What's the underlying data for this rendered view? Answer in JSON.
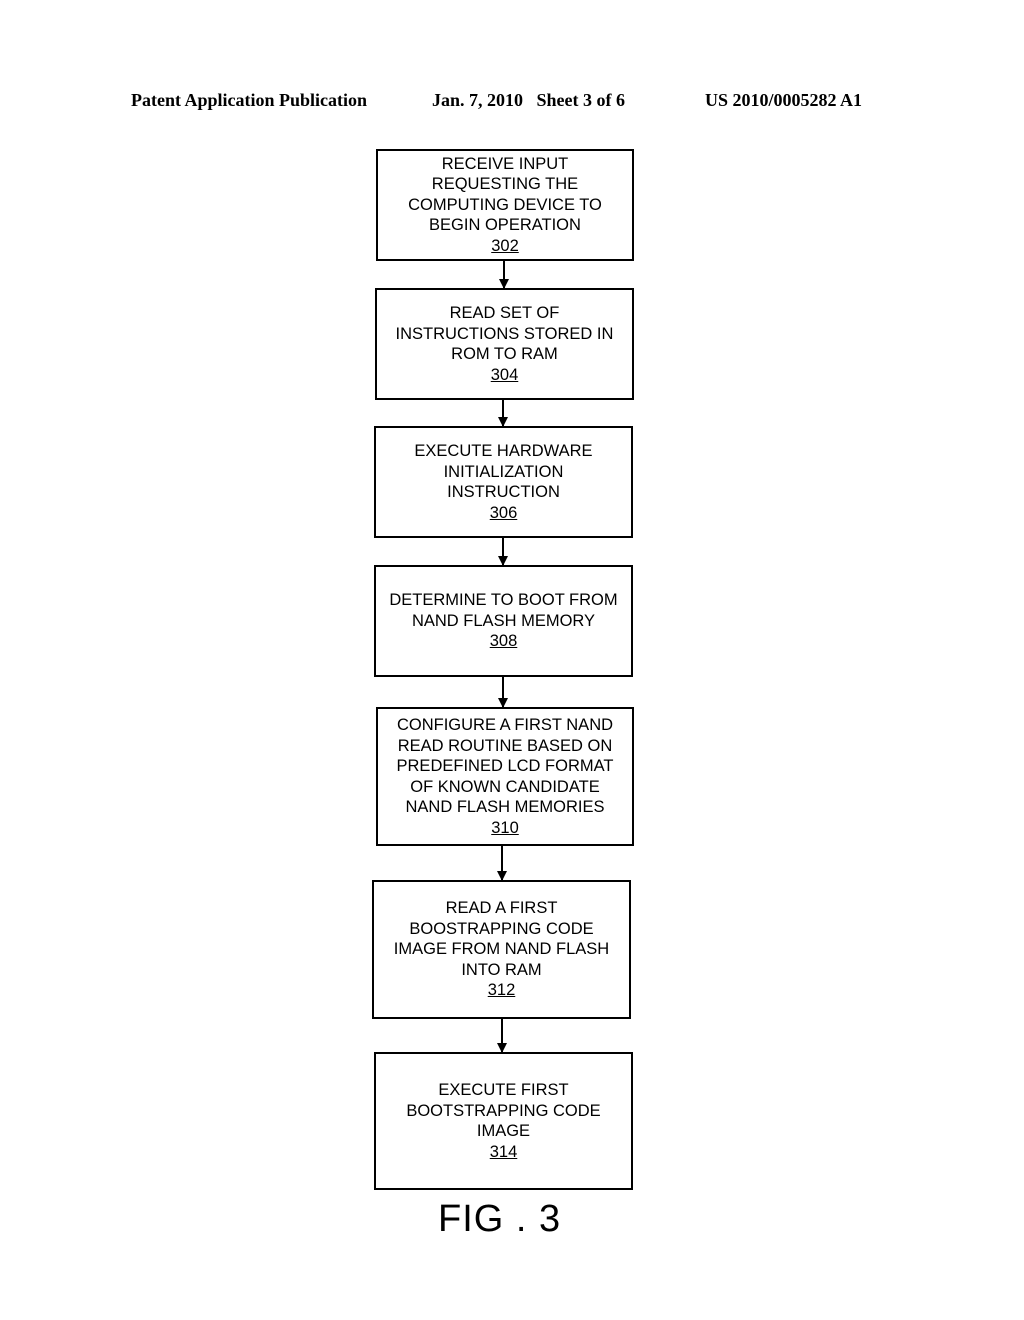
{
  "header": {
    "left": "Patent Application Publication",
    "middle": "Jan. 7, 2010   Sheet 3 of 6",
    "right": "US 2010/0005282 A1"
  },
  "flowchart": {
    "steps": [
      {
        "text": "RECEIVE INPUT\nREQUESTING THE\nCOMPUTING DEVICE TO\nBEGIN OPERATION",
        "ref": "302"
      },
      {
        "text": "READ SET OF\nINSTRUCTIONS STORED IN\nROM TO RAM",
        "ref": "304"
      },
      {
        "text": "EXECUTE HARDWARE\nINITIALIZATION\nINSTRUCTION",
        "ref": "306"
      },
      {
        "text": "DETERMINE TO BOOT FROM\nNAND FLASH MEMORY",
        "ref": "308"
      },
      {
        "text": "CONFIGURE A FIRST NAND\nREAD ROUTINE BASED ON\nPREDEFINED LCD FORMAT\nOF KNOWN CANDIDATE\nNAND FLASH MEMORIES",
        "ref": "310"
      },
      {
        "text": "READ A FIRST\nBOOSTRAPPING CODE\nIMAGE FROM NAND FLASH\nINTO RAM",
        "ref": "312"
      },
      {
        "text": "EXECUTE FIRST\nBOOTSTRAPPING CODE\nIMAGE",
        "ref": "314"
      }
    ],
    "figure_label": "FIG . 3"
  }
}
